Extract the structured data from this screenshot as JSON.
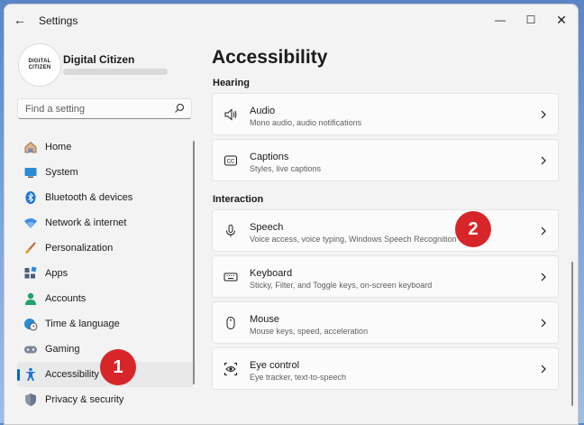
{
  "window": {
    "title": "Settings",
    "back": "←",
    "minimize": "—",
    "maximize": "☐",
    "close": "✕"
  },
  "profile": {
    "avatar_line1": "DIGITAL",
    "avatar_line2": "CITIZEN",
    "name": "Digital Citizen"
  },
  "search": {
    "placeholder": "Find a setting",
    "icon": "search-icon"
  },
  "sidebar": {
    "items": [
      {
        "label": "Home",
        "icon": "home-icon"
      },
      {
        "label": "System",
        "icon": "monitor-icon"
      },
      {
        "label": "Bluetooth & devices",
        "icon": "bluetooth-icon"
      },
      {
        "label": "Network & internet",
        "icon": "wifi-icon"
      },
      {
        "label": "Personalization",
        "icon": "brush-icon"
      },
      {
        "label": "Apps",
        "icon": "apps-icon"
      },
      {
        "label": "Accounts",
        "icon": "account-icon"
      },
      {
        "label": "Time & language",
        "icon": "globe-clock-icon"
      },
      {
        "label": "Gaming",
        "icon": "gamepad-icon"
      },
      {
        "label": "Accessibility",
        "icon": "accessibility-icon",
        "active": true
      },
      {
        "label": "Privacy & security",
        "icon": "shield-icon"
      }
    ]
  },
  "main": {
    "title": "Accessibility",
    "sections": [
      {
        "heading": "Hearing",
        "cards": [
          {
            "title": "Audio",
            "subtitle": "Mono audio, audio notifications",
            "icon": "speaker-icon"
          },
          {
            "title": "Captions",
            "subtitle": "Styles, live captions",
            "icon": "captions-icon"
          }
        ]
      },
      {
        "heading": "Interaction",
        "cards": [
          {
            "title": "Speech",
            "subtitle": "Voice access, voice typing, Windows Speech Recognition",
            "icon": "microphone-icon"
          },
          {
            "title": "Keyboard",
            "subtitle": "Sticky, Filter, and Toggle keys, on-screen keyboard",
            "icon": "keyboard-icon"
          },
          {
            "title": "Mouse",
            "subtitle": "Mouse keys, speed, acceleration",
            "icon": "mouse-icon"
          },
          {
            "title": "Eye control",
            "subtitle": "Eye tracker, text-to-speech",
            "icon": "eye-control-icon"
          }
        ]
      }
    ]
  },
  "annotations": {
    "badge1": "1",
    "badge2": "2",
    "color": "#d7262a"
  },
  "colors": {
    "accent": "#0067c0",
    "background": "#f3f3f3"
  }
}
